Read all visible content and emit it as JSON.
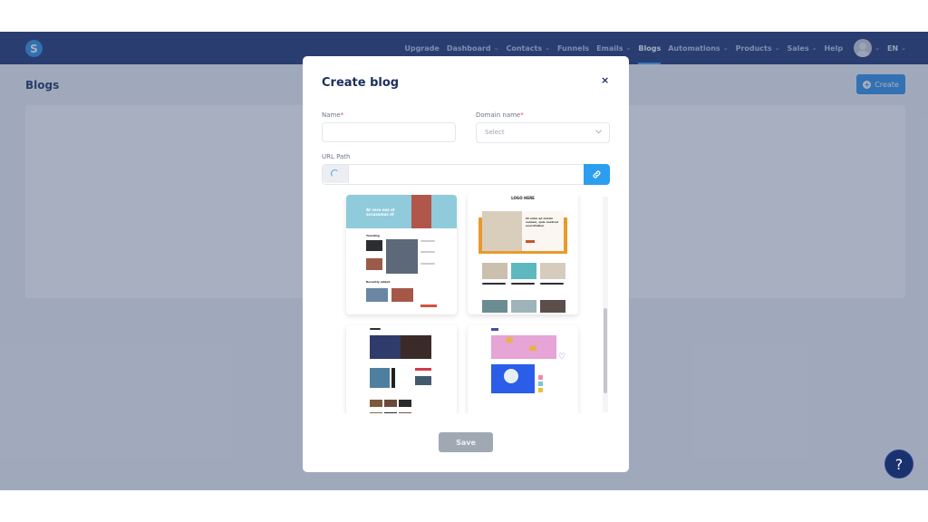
{
  "app": {
    "logo_letter": "S",
    "nav": [
      {
        "label": "Upgrade",
        "dropdown": false,
        "active": false
      },
      {
        "label": "Dashboard",
        "dropdown": true,
        "active": false
      },
      {
        "label": "Contacts",
        "dropdown": true,
        "active": false
      },
      {
        "label": "Funnels",
        "dropdown": false,
        "active": false
      },
      {
        "label": "Emails",
        "dropdown": true,
        "active": false
      },
      {
        "label": "Blogs",
        "dropdown": false,
        "active": true
      },
      {
        "label": "Automations",
        "dropdown": true,
        "active": false
      },
      {
        "label": "Products",
        "dropdown": true,
        "active": false
      },
      {
        "label": "Sales",
        "dropdown": true,
        "active": false
      },
      {
        "label": "Help",
        "dropdown": false,
        "active": false
      }
    ],
    "language": "EN",
    "chevron": "⌄"
  },
  "page": {
    "title": "Blogs",
    "create_label": "Create",
    "help_label": "?"
  },
  "modal": {
    "title": "Create blog",
    "close": "×",
    "name_label": "Name",
    "name_value": "",
    "domain_label": "Domain name",
    "required_mark": "*",
    "domain_placeholder": "Select",
    "url_label": "URL Path",
    "url_value": "",
    "save_label": "Save",
    "templates": [
      {
        "name": "template-trending",
        "hero_text": "At vero eos et accusamus et",
        "section1": "Trending",
        "section2": "Recently added"
      },
      {
        "name": "template-logo-here",
        "logo_text": "LOGO HERE",
        "hero_text": "Ut enim ad minim veniam, quis nostrud exercitation"
      },
      {
        "name": "template-magazine-dark"
      },
      {
        "name": "template-pink-pastel"
      }
    ]
  },
  "colors": {
    "nav_bg": "#1a3170",
    "accent": "#2c8fe8",
    "link_button": "#2c9ef0",
    "title": "#1b2e5e",
    "save_disabled": "#a0a9b3",
    "required": "#e0475d"
  }
}
